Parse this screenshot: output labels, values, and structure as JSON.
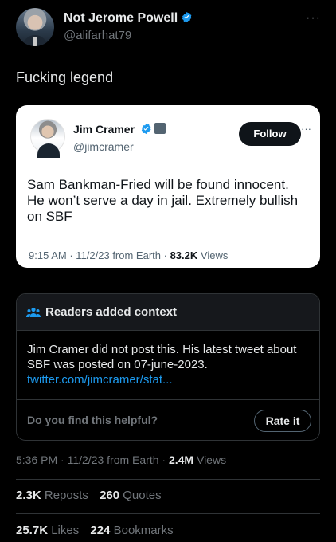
{
  "post": {
    "author": {
      "display_name": "Not Jerome Powell",
      "handle": "@alifarhat79",
      "verified": true
    },
    "more_glyph": "···",
    "text": "Fucking legend",
    "quoted_screenshot": {
      "author": {
        "display_name": "Jim Cramer",
        "handle": "@jimcramer",
        "verified": true
      },
      "follow_label": "Follow",
      "more_glyph": "···",
      "text": "Sam Bankman-Fried will be found innocent. He won’t serve a day in jail. Extremely bullish on SBF",
      "time": "9:15 AM",
      "date": "11/2/23",
      "source": "from Earth",
      "views_count": "83.2K",
      "views_label": "Views"
    },
    "community_note": {
      "title": "Readers added context",
      "body": "Jim Cramer did not post this. His latest tweet about SBF was posted on 07-june-2023.",
      "link_text": "twitter.com/jimcramer/stat...",
      "helpful_question": "Do you find this helpful?",
      "rate_label": "Rate it"
    },
    "meta": {
      "time": "5:36 PM",
      "date": "11/2/23",
      "source": "from Earth",
      "views_count": "2.4M",
      "views_label": "Views"
    },
    "stats": {
      "reposts_count": "2.3K",
      "reposts_label": "Reposts",
      "quotes_count": "260",
      "quotes_label": "Quotes",
      "likes_count": "25.7K",
      "likes_label": "Likes",
      "bookmarks_count": "224",
      "bookmarks_label": "Bookmarks"
    }
  },
  "colors": {
    "background": "#000000",
    "text_primary": "#e7e9ea",
    "text_secondary": "#71767b",
    "accent_blue": "#1d9bf0",
    "border": "#2f3336"
  }
}
